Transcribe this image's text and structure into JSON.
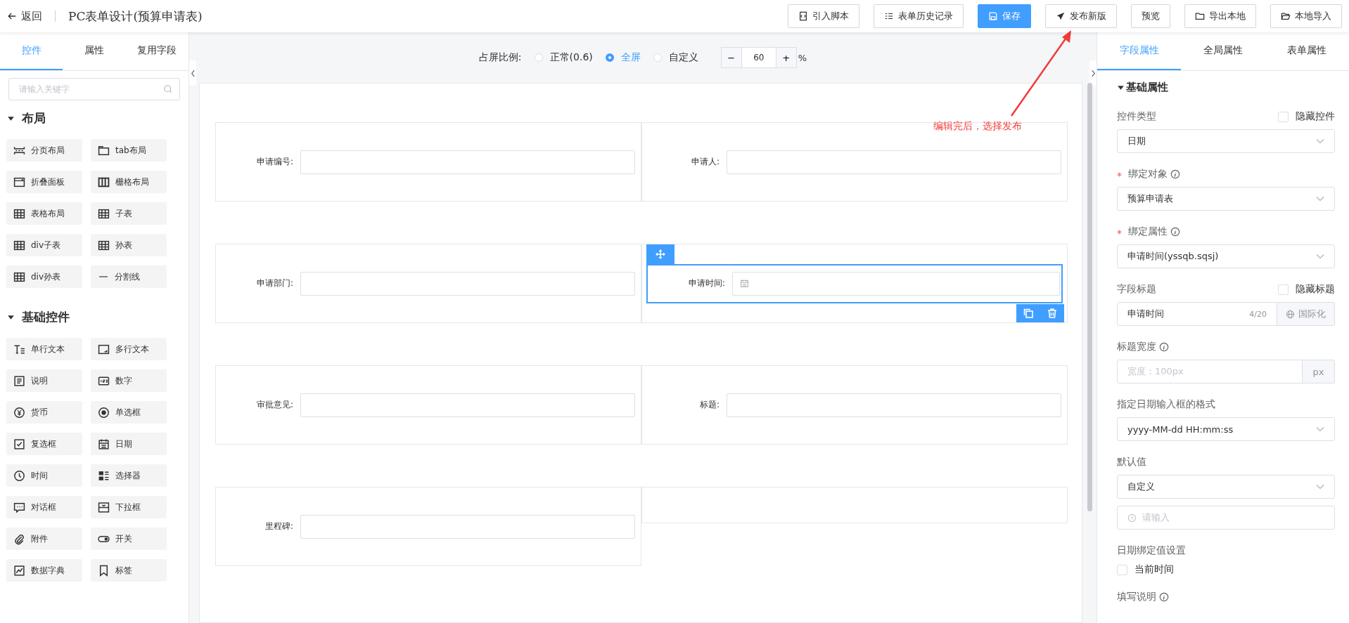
{
  "header": {
    "back": "返回",
    "title": "PC表单设计(预算申请表)",
    "buttons": [
      {
        "label": "引入脚本",
        "kind": "script",
        "primary": false
      },
      {
        "label": "表单历史记录",
        "kind": "list",
        "primary": false
      },
      {
        "label": "保存",
        "kind": "save",
        "primary": true
      },
      {
        "label": "发布新版",
        "kind": "send",
        "primary": false
      },
      {
        "label": "预览",
        "kind": "plain",
        "primary": false
      },
      {
        "label": "导出本地",
        "kind": "folder",
        "primary": false
      },
      {
        "label": "本地导入",
        "kind": "import",
        "primary": false
      }
    ]
  },
  "left_panel": {
    "tabs": [
      {
        "label": "控件",
        "selected": true
      },
      {
        "label": "属性",
        "selected": false
      },
      {
        "label": "复用字段",
        "selected": false
      }
    ],
    "search": {
      "placeholder": "请输入关键字"
    },
    "groups": [
      {
        "title": "布局",
        "expanded": true,
        "items": [
          {
            "label": "分页布局",
            "kind": "pages"
          },
          {
            "label": "tab布局",
            "kind": "tab"
          },
          {
            "label": "折叠面板",
            "kind": "collapse"
          },
          {
            "label": "栅格布局",
            "kind": "columns"
          },
          {
            "label": "表格布局",
            "kind": "table"
          },
          {
            "label": "子表",
            "kind": "table"
          },
          {
            "label": "div子表",
            "kind": "table"
          },
          {
            "label": "孙表",
            "kind": "table"
          },
          {
            "label": "div孙表",
            "kind": "table"
          },
          {
            "label": "分割线",
            "kind": "line"
          }
        ]
      },
      {
        "title": "基础控件",
        "expanded": true,
        "items": [
          {
            "label": "单行文本",
            "kind": "text"
          },
          {
            "label": "多行文本",
            "kind": "textarea"
          },
          {
            "label": "说明",
            "kind": "doc"
          },
          {
            "label": "数字",
            "kind": "number"
          },
          {
            "label": "货币",
            "kind": "currency"
          },
          {
            "label": "单选框",
            "kind": "radio"
          },
          {
            "label": "复选框",
            "kind": "checkbox"
          },
          {
            "label": "日期",
            "kind": "date"
          },
          {
            "label": "时间",
            "kind": "time"
          },
          {
            "label": "选择器",
            "kind": "selector"
          },
          {
            "label": "对话框",
            "kind": "dialog"
          },
          {
            "label": "下拉框",
            "kind": "dropdown"
          },
          {
            "label": "附件",
            "kind": "attachment"
          },
          {
            "label": "开关",
            "kind": "switch"
          },
          {
            "label": "数据字典",
            "kind": "dictionary"
          },
          {
            "label": "标签",
            "kind": "tag"
          }
        ]
      }
    ]
  },
  "canvas": {
    "ratio": {
      "label": "占屏比例:",
      "options": [
        {
          "label": "正常(0.6)",
          "selected": false
        },
        {
          "label": "全屏",
          "selected": true
        },
        {
          "label": "自定义",
          "selected": false
        }
      ],
      "zoom": {
        "minus": "−",
        "value": "60",
        "plus": "+",
        "unit": "%"
      }
    },
    "rows": [
      {
        "cells": [
          {
            "kind": "text",
            "label": "申请编号:",
            "selected": false
          },
          {
            "kind": "text",
            "label": "申请人:",
            "selected": false
          }
        ]
      },
      {
        "cells": [
          {
            "kind": "text",
            "label": "申请部门:",
            "selected": false
          },
          {
            "kind": "date",
            "label": "申请时间:",
            "selected": true
          }
        ]
      },
      {
        "cells": [
          {
            "kind": "text",
            "label": "审批意见:",
            "selected": false
          },
          {
            "kind": "text",
            "label": "标题:",
            "selected": false
          }
        ]
      },
      {
        "cells": [
          {
            "kind": "text",
            "label": "里程碑:",
            "selected": false
          },
          {
            "kind": "empty"
          }
        ]
      }
    ]
  },
  "annotation": {
    "text": "编辑完后，选择发布"
  },
  "right_panel": {
    "tabs": [
      {
        "label": "字段属性",
        "selected": true
      },
      {
        "label": "全局属性",
        "selected": false
      },
      {
        "label": "表单属性",
        "selected": false
      }
    ],
    "section": {
      "title": "基础属性",
      "expanded": true
    },
    "fields": [
      {
        "kind": "select",
        "label": "控件类型",
        "required": false,
        "info": false,
        "option": {
          "label": "隐藏控件",
          "checked": false
        },
        "value": "日期"
      },
      {
        "kind": "select",
        "label": "绑定对象",
        "required": true,
        "info": true,
        "value": "预算申请表"
      },
      {
        "kind": "select",
        "label": "绑定属性",
        "required": true,
        "info": true,
        "value": "申请时间(yssqb.sqsj)"
      },
      {
        "kind": "i18n",
        "label": "字段标题",
        "required": false,
        "info": false,
        "option": {
          "label": "隐藏标题",
          "checked": false
        },
        "value": "申请时间",
        "count": "4/20",
        "button": "国际化"
      },
      {
        "kind": "unit",
        "label": "标题宽度",
        "required": false,
        "info": true,
        "placeholder": "宽度：100px",
        "unit": "px"
      },
      {
        "kind": "select",
        "label": "指定日期输入框的格式",
        "required": false,
        "info": false,
        "value": "yyyy-MM-dd HH:mm:ss"
      },
      {
        "kind": "select",
        "label": "默认值",
        "required": false,
        "info": false,
        "value": "自定义"
      },
      {
        "kind": "clock",
        "placeholder": "请输入"
      },
      {
        "kind": "checkbox",
        "label": "日期绑定值设置",
        "required": false,
        "info": false,
        "text": "当前时间",
        "checked": false
      },
      {
        "kind": "note",
        "label": "填写说明",
        "required": false,
        "info": true
      }
    ]
  }
}
